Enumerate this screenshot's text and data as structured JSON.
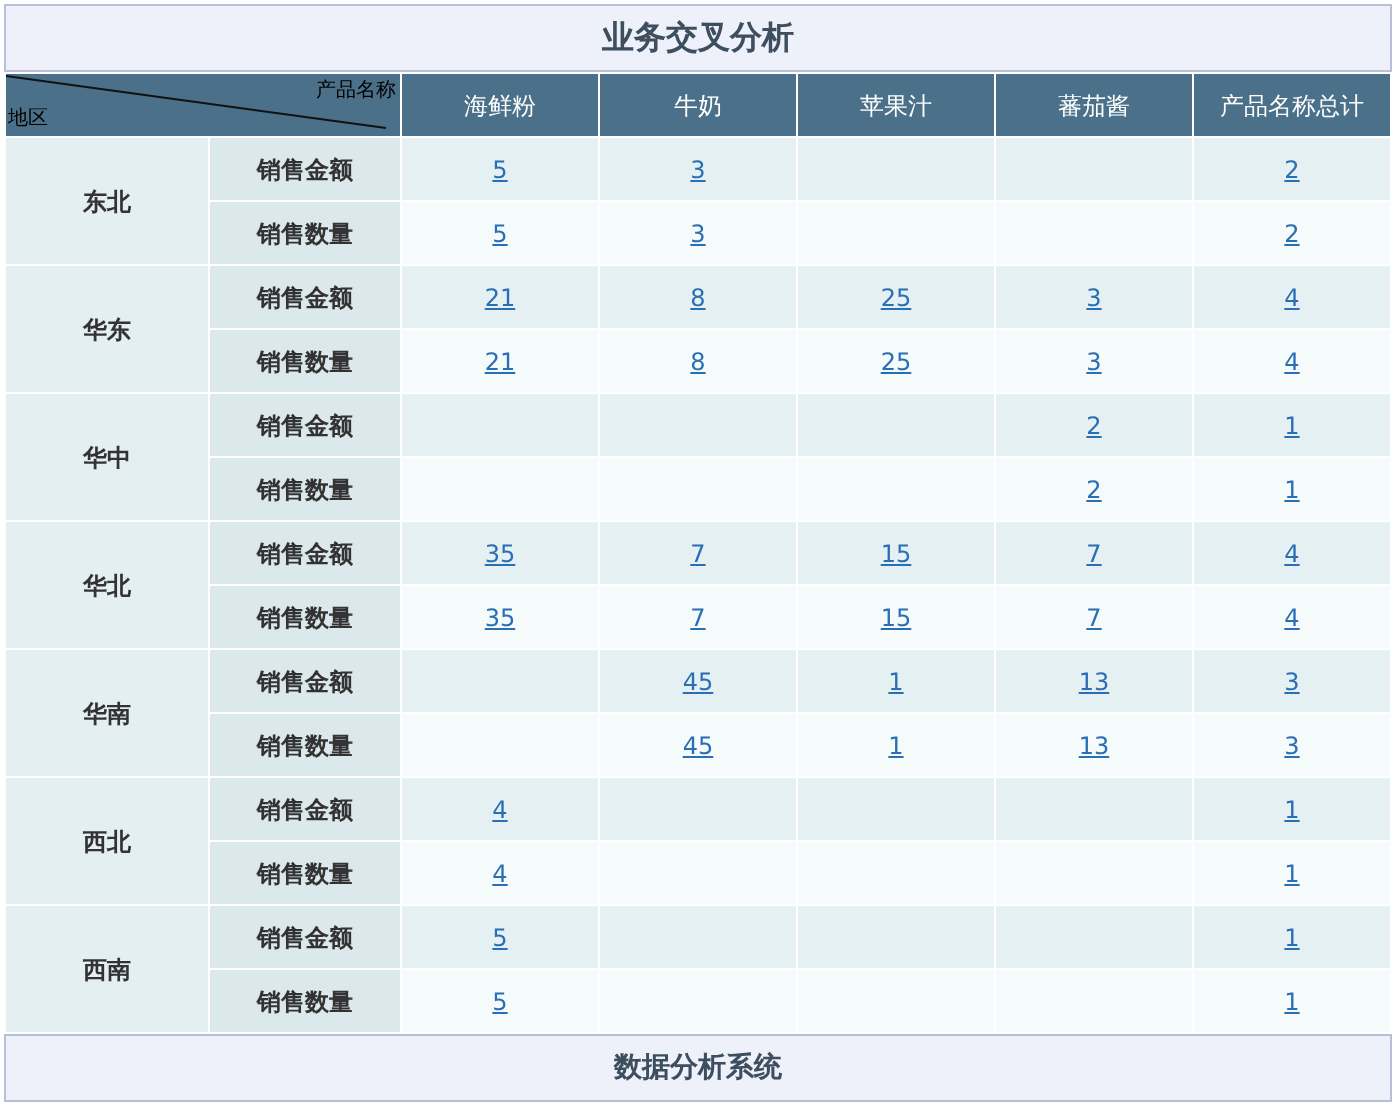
{
  "title": "业务交叉分析",
  "corner": {
    "column_label": "产品名称",
    "row_label": "地区"
  },
  "columns": [
    "海鲜粉",
    "牛奶",
    "苹果汁",
    "蕃茄酱",
    "产品名称总计"
  ],
  "regions": [
    {
      "name": "东北",
      "rows": [
        {
          "measure": "销售金额",
          "values": {
            "column_1": "5",
            "column_2": "3",
            "column_5": "2"
          }
        },
        {
          "measure": "销售数量",
          "values": {
            "column_1": "5",
            "column_2": "3",
            "column_5": "2"
          }
        }
      ]
    },
    {
      "name": "华东",
      "rows": [
        {
          "measure": "销售金额",
          "values": {
            "column_1": "21",
            "column_2": "8",
            "column_3": "25",
            "column_4": "3",
            "column_5": "4"
          }
        },
        {
          "measure": "销售数量",
          "values": {
            "column_1": "21",
            "column_2": "8",
            "column_3": "25",
            "column_4": "3",
            "column_5": "4"
          }
        }
      ]
    },
    {
      "name": "华中",
      "rows": [
        {
          "measure": "销售金额",
          "values": {
            "column_4": "2",
            "column_5": "1"
          }
        },
        {
          "measure": "销售数量",
          "values": {
            "column_4": "2",
            "column_5": "1"
          }
        }
      ]
    },
    {
      "name": "华北",
      "rows": [
        {
          "measure": "销售金额",
          "values": {
            "column_1": "35",
            "column_2": "7",
            "column_3": "15",
            "column_4": "7",
            "column_5": "4"
          }
        },
        {
          "measure": "销售数量",
          "values": {
            "column_1": "35",
            "column_2": "7",
            "column_3": "15",
            "column_4": "7",
            "column_5": "4"
          }
        }
      ]
    },
    {
      "name": "华南",
      "rows": [
        {
          "measure": "销售金额",
          "values": {
            "column_2": "45",
            "column_3": "1",
            "column_4": "13",
            "column_5": "3"
          }
        },
        {
          "measure": "销售数量",
          "values": {
            "column_2": "45",
            "column_3": "1",
            "column_4": "13",
            "column_5": "3"
          }
        }
      ]
    },
    {
      "name": "西北",
      "rows": [
        {
          "measure": "销售金额",
          "values": {
            "column_1": "4",
            "column_5": "1"
          }
        },
        {
          "measure": "销售数量",
          "values": {
            "column_1": "4",
            "column_5": "1"
          }
        }
      ]
    },
    {
      "name": "西南",
      "rows": [
        {
          "measure": "销售金额",
          "values": {
            "column_1": "5",
            "column_5": "1"
          }
        },
        {
          "measure": "销售数量",
          "values": {
            "column_1": "5",
            "column_5": "1"
          }
        }
      ]
    }
  ],
  "footer": "数据分析系统"
}
